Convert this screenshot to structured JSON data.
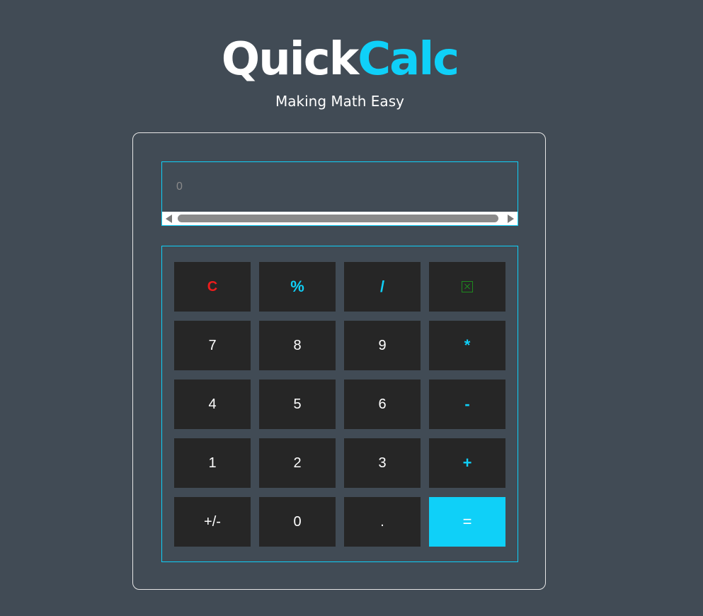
{
  "header": {
    "title_part1": "Quick",
    "title_part2": "Calc",
    "subtitle": "Making Math Easy"
  },
  "display": {
    "value": "0"
  },
  "keys": {
    "clear": "C",
    "percent": "%",
    "divide": "/",
    "delete_icon": "backspace-icon",
    "seven": "7",
    "eight": "8",
    "nine": "9",
    "multiply": "*",
    "four": "4",
    "five": "5",
    "six": "6",
    "minus": "-",
    "one": "1",
    "two": "2",
    "three": "3",
    "plus": "+",
    "negate": "+/-",
    "zero": "0",
    "decimal": ".",
    "equals": "="
  },
  "colors": {
    "background": "#414b55",
    "accent": "#0fd0f8",
    "key_background": "#262626",
    "clear_color": "#ee1c1c",
    "delete_color": "#1e8a1e"
  }
}
